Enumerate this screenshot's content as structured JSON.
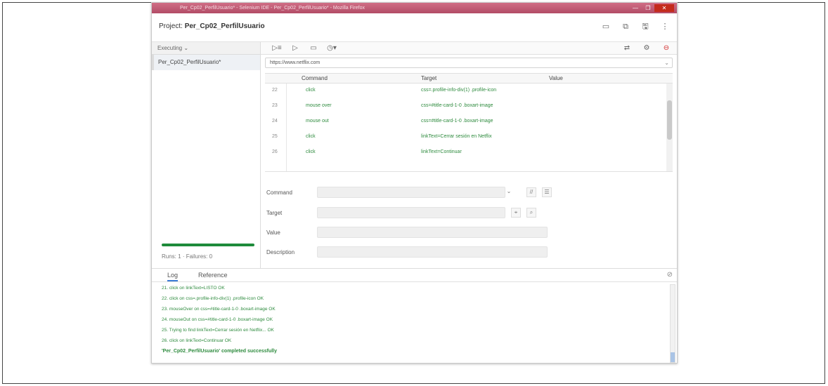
{
  "window": {
    "title": "Per_Cp02_PerfilUsuario* - Selenium IDE - Per_Cp02_PerfilUsuario* - Mozilla Firefox",
    "controls": [
      "—",
      "❐",
      "✕"
    ]
  },
  "project": {
    "label": "Project:",
    "name": "Per_Cp02_PerfilUsuario"
  },
  "sidebar": {
    "mode_dropdown": "Executing",
    "suite_item": "Per_Cp02_PerfilUsuario*",
    "runs_text": "Runs: 1",
    "failures_text": "Failures: 0",
    "progress": 1.0
  },
  "url_bar": {
    "value": "https://www.netflix.com"
  },
  "table": {
    "headers": {
      "command": "Command",
      "target": "Target",
      "value": "Value"
    },
    "rows": [
      {
        "num": "22",
        "command": "click",
        "target": "css=.profile-info-div(1) .profile-icon"
      },
      {
        "num": "23",
        "command": "mouse over",
        "target": "css=#title-card-1-0 .boxart-image"
      },
      {
        "num": "24",
        "command": "mouse out",
        "target": "css=#title-card-1-0 .boxart-image"
      },
      {
        "num": "25",
        "command": "click",
        "target": "linkText=Cerrar sesión en Netflix"
      },
      {
        "num": "26",
        "command": "click",
        "target": "linkText=Continuar"
      }
    ]
  },
  "form": {
    "command_label": "Command",
    "target_label": "Target",
    "value_label": "Value",
    "description_label": "Description"
  },
  "log": {
    "tabs": [
      "Log",
      "Reference"
    ],
    "lines": [
      "21. click on linkText=LISTO OK",
      "22. click on css=.profile-info-div(1) .profile-icon OK",
      "23. mouseOver on css=#title-card-1-0 .boxart-image OK",
      "24. mouseOut on css=#title-card-1-0 .boxart-image OK",
      "25. Trying to find linkText=Cerrar sesión en Netflix... OK",
      "26. click on linkText=Continuar OK"
    ],
    "completed": "'Per_Cp02_PerfilUsuario' completed successfully"
  }
}
